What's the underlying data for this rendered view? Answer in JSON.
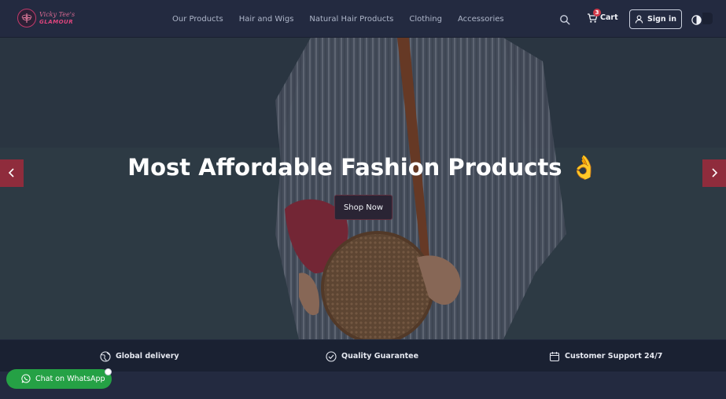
{
  "brand": {
    "line1": "Vicky Tee's",
    "line2": "GLAMOUR",
    "logo_icon": "dragonfly-icon"
  },
  "nav": {
    "items": [
      "Our Products",
      "Hair and Wigs",
      "Natural Hair Products",
      "Clothing",
      "Accessories"
    ],
    "search_icon": "search-icon",
    "cart": {
      "label": "Cart",
      "count": "3",
      "icon": "cart-icon"
    },
    "signin": {
      "label": "Sign in",
      "icon": "user-icon"
    },
    "theme_icon": "half-moon-icon"
  },
  "hero": {
    "title": "Most Affordable Fashion Products 👌",
    "cta": "Shop Now",
    "prev_icon": "chevron-left-icon",
    "next_icon": "chevron-right-icon"
  },
  "features": [
    {
      "icon": "globe-icon",
      "label": "Global delivery"
    },
    {
      "icon": "check-circle-icon",
      "label": "Quality Guarantee"
    },
    {
      "icon": "calendar-icon",
      "label": "Customer Support 24/7"
    }
  ],
  "whatsapp": {
    "label": "Chat on WhatsApp",
    "icon": "whatsapp-icon"
  },
  "colors": {
    "nav_bg": "#232a40",
    "accent_red": "#8f2c3c",
    "whatsapp_green": "#25a145",
    "badge_red": "#d23a4a"
  }
}
